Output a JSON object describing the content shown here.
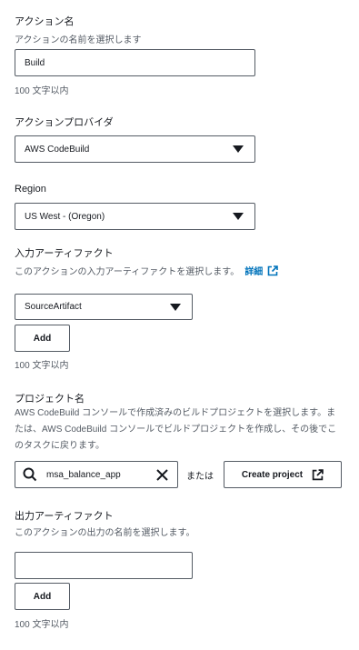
{
  "action_name": {
    "label": "アクション名",
    "description": "アクションの名前を選択します",
    "value": "Build",
    "constraint": "100 文字以内"
  },
  "action_provider": {
    "label": "アクションプロバイダ",
    "selected": "AWS CodeBuild"
  },
  "region": {
    "label": "Region",
    "selected": "US West - (Oregon)"
  },
  "input_artifacts": {
    "label": "入力アーティファクト",
    "description": "このアクションの入力アーティファクトを選択します。",
    "info_link": "詳細",
    "selected": "SourceArtifact",
    "add_label": "Add",
    "constraint": "100 文字以内"
  },
  "project_name": {
    "label": "プロジェクト名",
    "description": "AWS CodeBuild コンソールで作成済みのビルドプロジェクトを選択します。または、AWS CodeBuild コンソールでビルドプロジェクトを作成し、その後でこのタスクに戻ります。",
    "value": "msa_balance_app",
    "or_text": "または",
    "create_label": "Create project"
  },
  "output_artifacts": {
    "label": "出力アーティファクト",
    "description": "このアクションの出力の名前を選択します。",
    "value": "",
    "add_label": "Add",
    "constraint": "100 文字以内"
  },
  "colors": {
    "text": "#16191f",
    "secondary": "#545b64",
    "link": "#0073bb",
    "border": "#545b64"
  },
  "icons": [
    "chevron-down-icon",
    "external-link-icon",
    "search-icon",
    "clear-icon"
  ]
}
